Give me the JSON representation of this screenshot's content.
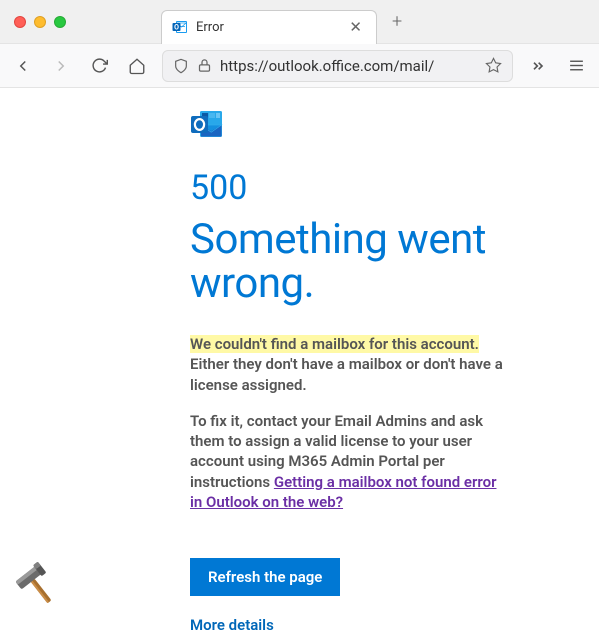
{
  "window": {
    "tab": {
      "title": "Error"
    },
    "newtab_tooltip": "+"
  },
  "toolbar": {
    "url": "https://outlook.office.com/mail/"
  },
  "page": {
    "error_code": "500",
    "heading": "Something went wrong.",
    "highlighted": "We couldn't find a mailbox for this account.",
    "remainder": " Either they don't have a mailbox or don't have a license assigned.",
    "fix_prefix": "To fix it, contact your Email Admins and ask them to assign a valid license to your user account using M365 Admin Portal per instructions ",
    "link_text": "Getting a mailbox not found error in Outlook on the web?",
    "refresh_label": "Refresh the page",
    "more_label": "More details"
  }
}
